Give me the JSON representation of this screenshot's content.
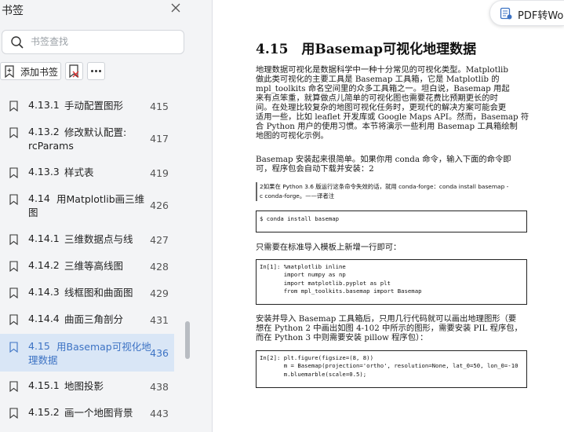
{
  "sidebar": {
    "title": "书签",
    "search_placeholder": "书签查找",
    "add_bookmark_label": "添加书签",
    "items": [
      {
        "num": "4.13.1",
        "title": "手动配置图形",
        "page": "415"
      },
      {
        "num": "4.13.2",
        "title": "修改默认配置:",
        "title2": "rcParams",
        "page": "417"
      },
      {
        "num": "4.13.3",
        "title": "样式表",
        "page": "419"
      },
      {
        "num": "4.14",
        "title": "用Matplotlib画三维",
        "title2": "图",
        "page": "426"
      },
      {
        "num": "4.14.1",
        "title": "三维数据点与线",
        "page": "427"
      },
      {
        "num": "4.14.2",
        "title": "三维等高线图",
        "page": "428"
      },
      {
        "num": "4.14.3",
        "title": "线框图和曲面图",
        "page": "429"
      },
      {
        "num": "4.14.4",
        "title": "曲面三角剖分",
        "page": "431"
      },
      {
        "num": "4.15",
        "title": "用Basemap可视化地",
        "title2": "理数据",
        "page": "436"
      },
      {
        "num": "4.15.1",
        "title": "地图投影",
        "page": "438"
      },
      {
        "num": "4.15.2",
        "title": "画一个地图背景",
        "page": "443"
      }
    ]
  },
  "pdf_convert_label": "PDF转Wor",
  "document": {
    "section_title": "4.15　用Basemap可视化地理数据",
    "p1": [
      "地理数据可视化是数据科学中一种十分常见的可视化类型。Matplotlib",
      "做此类可视化的主要工具是 Basemap 工具箱，它是 Matplotlib 的",
      "mpl_toolkits 命名空间里的众多工具箱之一。坦白说，Basemap 用起",
      "来有点笨重，就算做点儿简单的可视化图也需要花费比预期更长的时",
      "间。在处理比较复杂的地图可视化任务时，更现代的解决方案可能会更",
      "适用一些，比如 leaflet 开发库或 Google Maps API。然而，Basemap 符",
      "合 Python 用户的使用习惯。本节将演示一些利用 Basemap 工具箱绘制",
      "地图的可视化示例。"
    ],
    "p2": [
      "Basemap 安装起来很简单。如果你用 conda 命令，输入下面的命令即",
      "可，程序包会自动下载并安装：2"
    ],
    "footnote": [
      "2如果在 Python 3.6 版运行这条命令失效的话，就用 conda-forge：conda install basemap -",
      "c conda-forge。——译者注"
    ],
    "code1": "$ conda install basemap",
    "p3": "只需要在标准导入模板上新增一行即可：",
    "code2": "In[1]: %matplotlib inline\n       import numpy as np\n       import matplotlib.pyplot as plt\n       from mpl_toolkits.basemap import Basemap",
    "p4": [
      "安装并导入 Basemap 工具箱后，只用几行代码就可以画出地理图形（要",
      "想在 Python 2 中画出如图 4-102 中所示的图形，需要安装 PIL 程序包，",
      "而在 Python 3 中则需要安装 pillow 程序包）："
    ],
    "code3": "In[2]: plt.figure(figsize=(8, 8))\n       m = Basemap(projection='ortho', resolution=None, lat_0=50, lon_0=-10\n       m.bluemarble(scale=0.5);"
  }
}
